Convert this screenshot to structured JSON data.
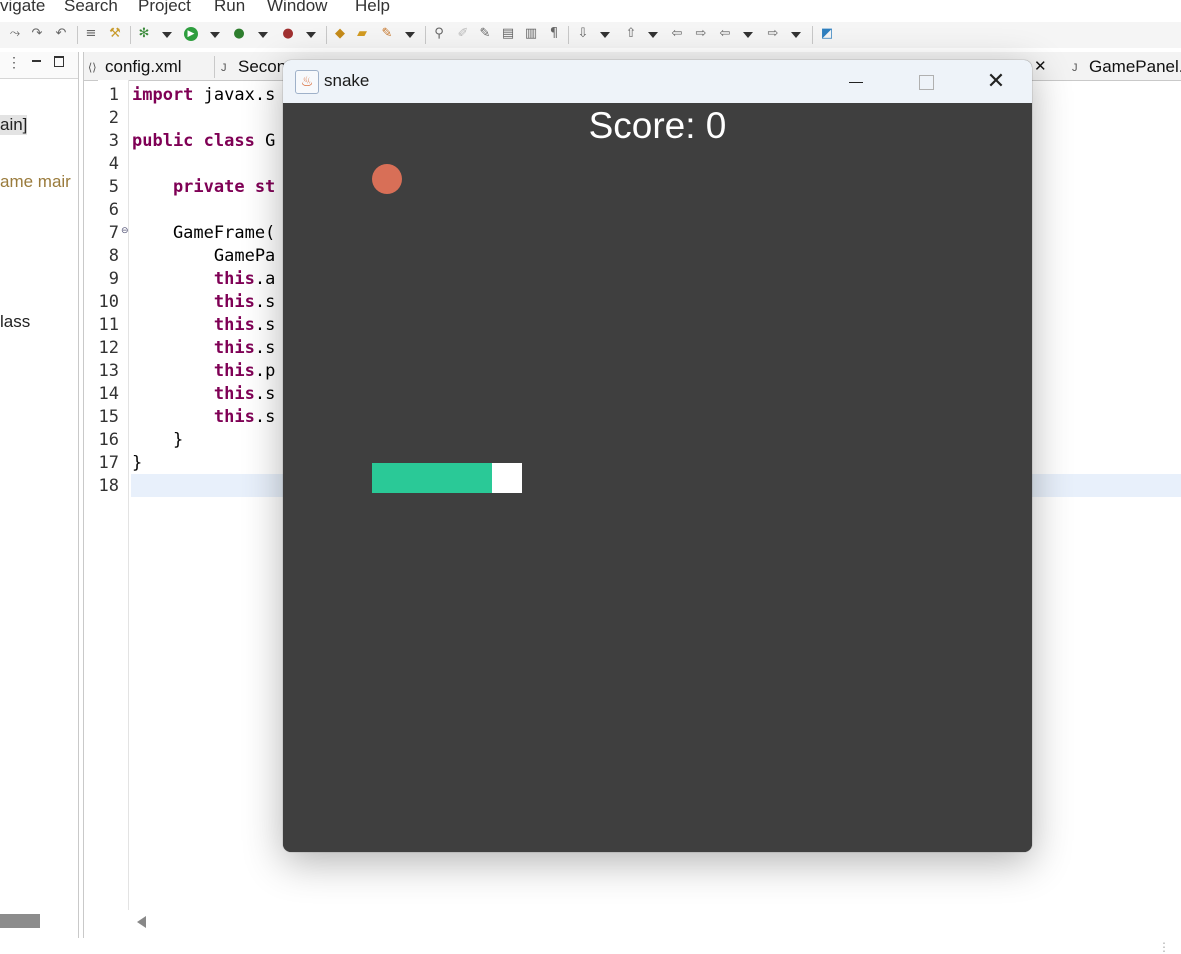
{
  "menu": {
    "items": [
      "vigate",
      "Search",
      "Project",
      "Run",
      "Window",
      "Help"
    ]
  },
  "toolbar": {
    "icons": [
      "skip-all-breakpoints-icon",
      "step-over-icon",
      "step-return-icon",
      "toggle-ant-icon",
      "build-icon",
      "debug-icon",
      "run-icon",
      "coverage-icon",
      "external-tools-icon",
      "new-java-project-icon",
      "open-type-icon",
      "search-icon",
      "annotation-icon",
      "last-edit-icon",
      "mark-occurrences-icon",
      "block-selection-icon",
      "show-whitespace-icon",
      "word-wrap-icon",
      "next-annotation-icon",
      "previous-annotation-icon",
      "last-edit-location-icon",
      "back-icon",
      "forward-icon",
      "open-perspective-icon"
    ]
  },
  "left_panel": {
    "texts": [
      "ain]",
      "ame mair",
      "lass"
    ]
  },
  "tabs": [
    {
      "label": "config.xml",
      "icon": "xml-file-icon"
    },
    {
      "label": "Secon",
      "icon": "java-file-icon"
    },
    {
      "label": "GamePanel.",
      "icon": "java-file-icon"
    }
  ],
  "tab_close": "✕",
  "editor": {
    "line_numbers": [
      "1",
      "2",
      "3",
      "4",
      "5",
      "6",
      "7",
      "8",
      "9",
      "10",
      "11",
      "12",
      "13",
      "14",
      "15",
      "16",
      "17",
      "18"
    ],
    "lines": [
      {
        "kw": "import",
        "rest": " javax.s"
      },
      {
        "kw": "",
        "rest": ""
      },
      {
        "kw": "public class",
        "rest": " G"
      },
      {
        "kw": "",
        "rest": ""
      },
      {
        "kw": "    private st",
        "rest": ""
      },
      {
        "kw": "",
        "rest": ""
      },
      {
        "kw": "",
        "rest": "    GameFrame("
      },
      {
        "kw": "",
        "rest": "        GamePa"
      },
      {
        "kw": "        this",
        "rest": ".a"
      },
      {
        "kw": "        this",
        "rest": ".s"
      },
      {
        "kw": "        this",
        "rest": ".s"
      },
      {
        "kw": "        this",
        "rest": ".s"
      },
      {
        "kw": "        this",
        "rest": ".p"
      },
      {
        "kw": "        this",
        "rest": ".s"
      },
      {
        "kw": "        this",
        "rest": ".s"
      },
      {
        "kw": "",
        "rest": "    }"
      },
      {
        "kw": "",
        "rest": "}"
      },
      {
        "kw": "",
        "rest": ""
      }
    ]
  },
  "game_window": {
    "title": "snake",
    "icon": "java-cup-icon",
    "controls": {
      "minimize": "minimize-icon",
      "maximize": "maximize-icon",
      "close": "✕"
    },
    "score_text": "Score: 0",
    "score": 0,
    "colors": {
      "background": "#3f3f3f",
      "apple": "#d86f57",
      "snake_body": "#2ac997",
      "snake_head": "#ffffff",
      "score_text": "#ffffff"
    },
    "snake_segments": 5
  }
}
